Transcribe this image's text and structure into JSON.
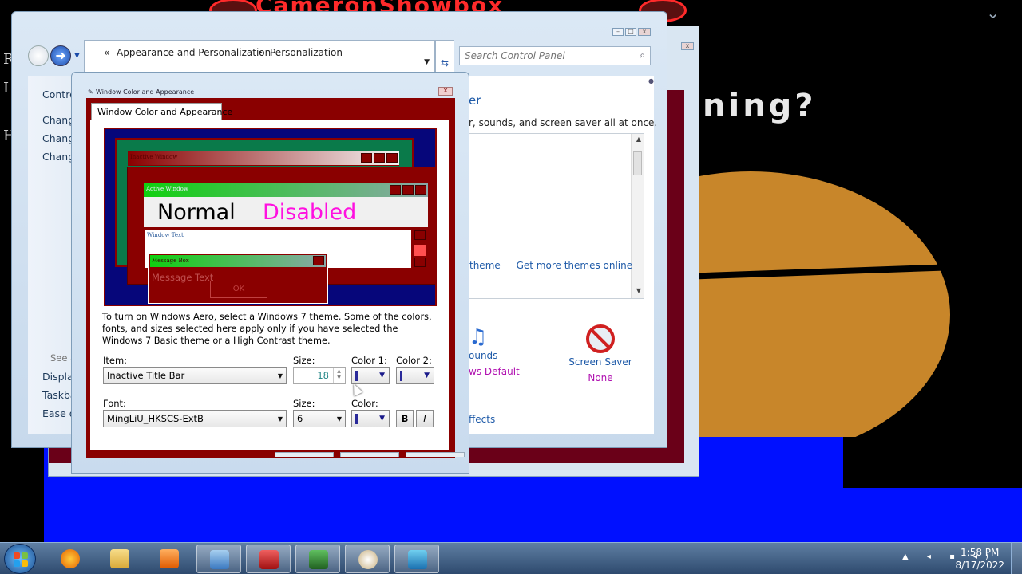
{
  "wallpaper": {
    "top_text": "CameronShowbox",
    "top_badge_left": "38",
    "top_badge_right": "38",
    "big_text": "ning?",
    "left_letters": [
      "R",
      "I",
      "H"
    ]
  },
  "control_panel": {
    "breadcrumb": {
      "root_glyph": "«",
      "items": [
        "Appearance and Personalization",
        "Personalization"
      ],
      "separator": "▸"
    },
    "search_placeholder": "Search Control Panel",
    "left_links": [
      "Contro",
      "Change",
      "Change",
      "Change"
    ],
    "see_also": "See a",
    "bottom_links": [
      "Display",
      "Taskba",
      "Ease of"
    ],
    "heading": "er",
    "description": "r, sounds, and screen saver all at once.",
    "theme_links": {
      "save": "theme",
      "more": "Get more themes online"
    },
    "sounds": {
      "name": "ounds",
      "value": "ws Default"
    },
    "screen_saver": {
      "name": "Screen Saver",
      "value": "None"
    },
    "effects_link": "ffects"
  },
  "dialog": {
    "title": "Window Color and Appearance",
    "tab_label": "Window Color and Appearance",
    "preview": {
      "inactive_title": "Inactive Window",
      "active_title": "Active Window",
      "normal": "Normal",
      "disabled": "Disabled",
      "window_text": "Window Text",
      "message_box_title": "Message Box",
      "message_text": "Message Text",
      "ok": "OK"
    },
    "instructions": "To turn on Windows Aero, select a Windows 7 theme.  Some of the colors, fonts, and sizes selected here apply only if you have selected the Windows 7 Basic theme or a High Contrast theme.",
    "item_label": "Item:",
    "item_value": "Inactive Title Bar",
    "size_label": "Size:",
    "size_value": "18",
    "color1_label": "Color 1:",
    "color2_label": "Color 2:",
    "font_label": "Font:",
    "font_value": "MingLiU_HKSCS-ExtB",
    "font_size_label": "Size:",
    "font_size_value": "6",
    "font_color_label": "Color:",
    "bold_label": "B",
    "italic_label": "I"
  },
  "taskbar": {
    "time": "1:58 PM",
    "date": "8/17/2022",
    "tray_icons": "▲ ◂ ▪ ◂)"
  },
  "colors": {
    "dialog_body": "#8a0000",
    "preview_background": "#06067a",
    "active_title": "#10d010",
    "disabled_text": "#ff10e0",
    "link": "#1e5aa8"
  }
}
